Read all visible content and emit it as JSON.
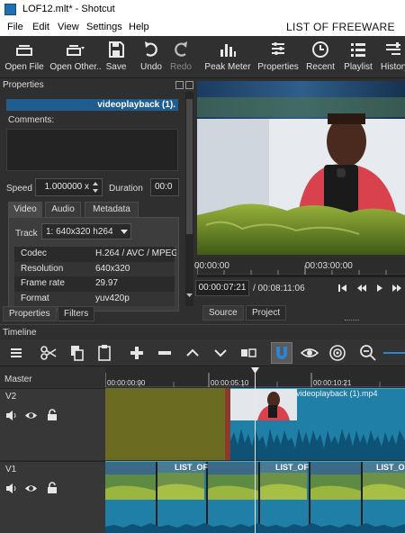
{
  "window": {
    "title": "LOF12.mlt* - Shotcut"
  },
  "menu": {
    "items": [
      "File",
      "Edit",
      "View",
      "Settings",
      "Help"
    ],
    "overlay_text": "LIST OF FREEWARE"
  },
  "toolbar": {
    "buttons": [
      {
        "label": "Open File",
        "icon": "open-file-icon",
        "enabled": true
      },
      {
        "label": "Open Other..",
        "icon": "open-other-icon",
        "enabled": true
      },
      {
        "label": "Save",
        "icon": "save-icon",
        "enabled": true
      },
      {
        "label": "Undo",
        "icon": "undo-icon",
        "enabled": true
      },
      {
        "label": "Redo",
        "icon": "redo-icon",
        "enabled": false
      },
      {
        "label": "Peak Meter",
        "icon": "peak-meter-icon",
        "enabled": true
      },
      {
        "label": "Properties",
        "icon": "properties-icon",
        "enabled": true
      },
      {
        "label": "Recent",
        "icon": "recent-icon",
        "enabled": true
      },
      {
        "label": "Playlist",
        "icon": "playlist-icon",
        "enabled": true
      },
      {
        "label": "History",
        "icon": "history-icon",
        "enabled": true
      }
    ]
  },
  "properties": {
    "header": "Properties",
    "clip_name": "videoplayback (1).",
    "comments_label": "Comments:",
    "comments_value": "",
    "speed_label": "Speed",
    "speed_value": "1.000000 x",
    "duration_label": "Duration",
    "duration_value": "00:0",
    "tabs": [
      "Video",
      "Audio",
      "Metadata"
    ],
    "active_tab": "Video",
    "track_label": "Track",
    "track_value": "1: 640x320 h264",
    "info": [
      {
        "key": "Codec",
        "value": "H.264 / AVC / MPEG"
      },
      {
        "key": "Resolution",
        "value": "640x320"
      },
      {
        "key": "Frame rate",
        "value": "29.97"
      },
      {
        "key": "Format",
        "value": "yuv420p"
      }
    ],
    "dock_tabs": [
      "Properties",
      "Filters"
    ]
  },
  "player": {
    "ruler_labels": [
      "00:00:00",
      "00:03:00:00"
    ],
    "current_timecode": "00:00:07:21",
    "total_timecode": "/ 00:08:11:06",
    "dock_tabs": [
      "Source",
      "Project"
    ],
    "colors": {
      "sky": "#1e3f64",
      "shirt": "#d9414d",
      "grass": "#7d9a2e"
    }
  },
  "timeline": {
    "title": "Timeline",
    "master_label": "Master",
    "ruler_labels": [
      "00:00:00:00",
      "00:00:05:10",
      "00:00:10:21"
    ],
    "tracks": [
      {
        "name": "V2",
        "clip_label": "videoplayback (1).mp4"
      },
      {
        "name": "V1",
        "clip_label": "LIST_OF"
      }
    ],
    "colors": {
      "clip_blue": "#1f7fa7",
      "waveform": "#0e5275",
      "blank_v2": "#6b6b22",
      "accent": "#2a86d3"
    }
  }
}
